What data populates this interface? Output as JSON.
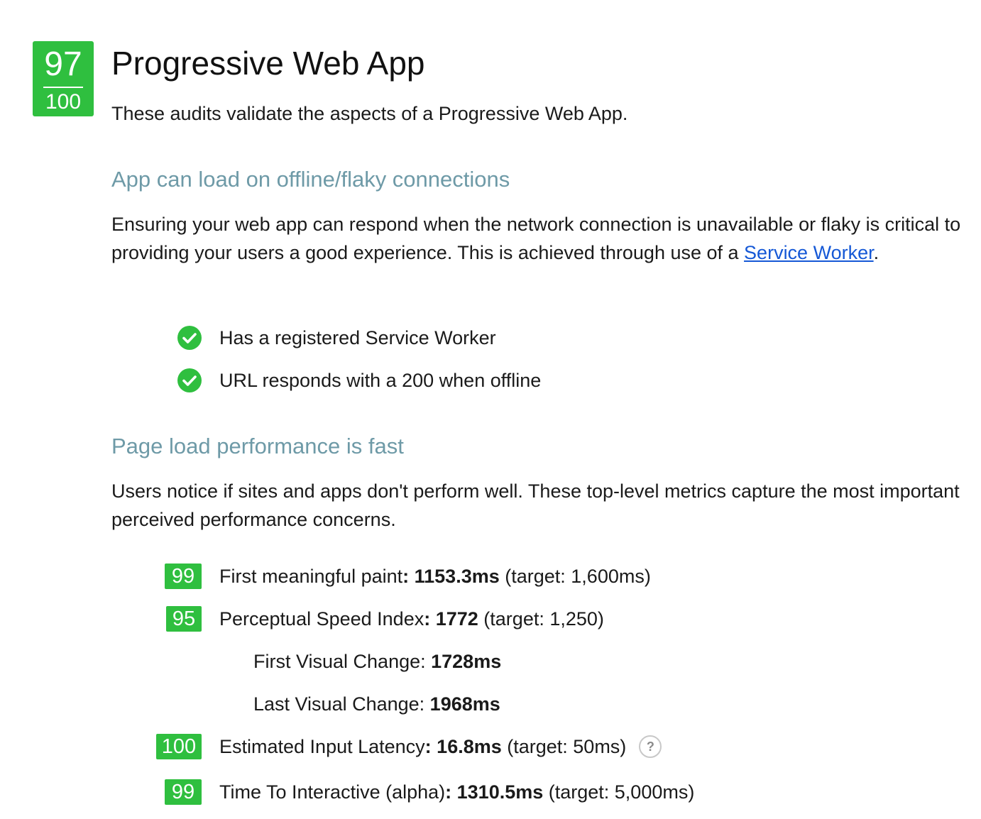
{
  "header": {
    "score": "97",
    "total": "100",
    "title": "Progressive Web App",
    "subtitle": "These audits validate the aspects of a Progressive Web App."
  },
  "sections": [
    {
      "heading": "App can load on offline/flaky connections",
      "description_before_link": "Ensuring your web app can respond when the network connection is unavailable or flaky is critical to providing your users a good experience. This is achieved through use of a ",
      "link_text": "Service Worker",
      "description_after_link": ".",
      "audits": [
        {
          "label": "Has a registered Service Worker",
          "status": "pass",
          "icon": "check-circle-icon"
        },
        {
          "label": "URL responds with a 200 when offline",
          "status": "pass",
          "icon": "check-circle-icon"
        }
      ]
    },
    {
      "heading": "Page load performance is fast",
      "description": "Users notice if sites and apps don't perform well. These top-level metrics capture the most important perceived performance concerns.",
      "metrics": [
        {
          "score": "99",
          "name": "First meaningful paint",
          "sep": ": ",
          "value": "1153.3ms",
          "target": " (target: 1,600ms)"
        },
        {
          "score": "95",
          "name": "Perceptual Speed Index",
          "sep": ": ",
          "value": "1772",
          "target": " (target: 1,250)",
          "sub": [
            {
              "name": "First Visual Change: ",
              "value": "1728ms"
            },
            {
              "name": "Last Visual Change: ",
              "value": "1968ms"
            }
          ]
        },
        {
          "score": "100",
          "name": "Estimated Input Latency",
          "sep": ": ",
          "value": "16.8ms",
          "target": " (target: 50ms)",
          "help": "?",
          "help_icon": "question-circle-icon"
        },
        {
          "score": "99",
          "name": "Time To Interactive (alpha)",
          "sep": ": ",
          "value": "1310.5ms",
          "target": " (target: 5,000ms)"
        }
      ]
    }
  ],
  "colors": {
    "badge_green": "#2fbf3f",
    "heading_teal": "#6e9aa7",
    "link_blue": "#1558d6"
  }
}
